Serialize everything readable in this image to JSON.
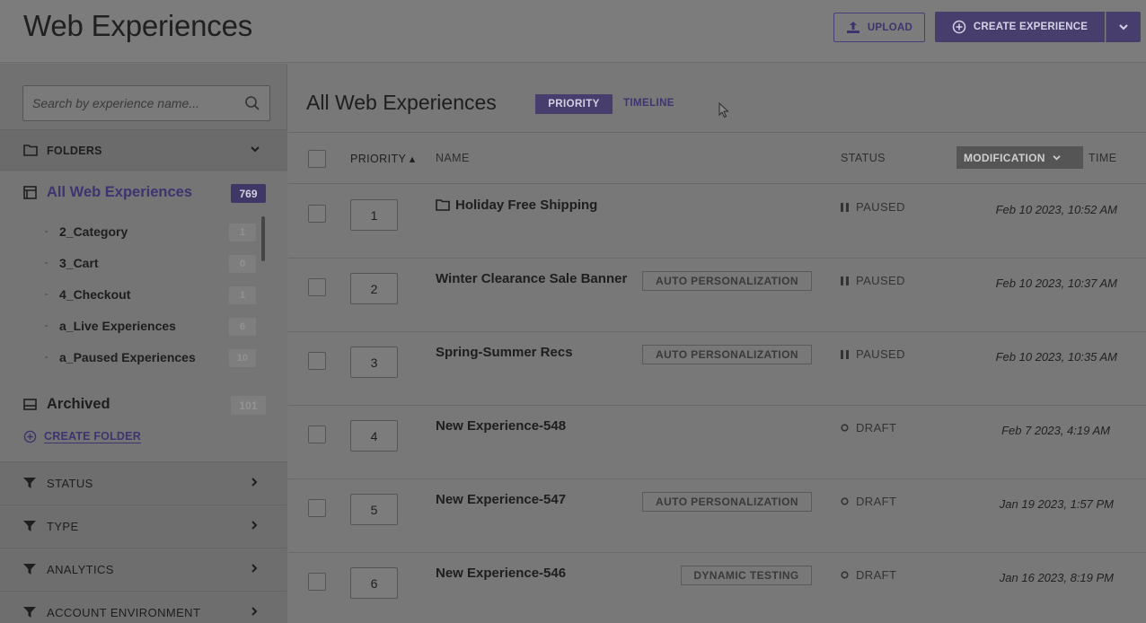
{
  "header": {
    "title": "Web Experiences",
    "upload_label": "UPLOAD",
    "create_label": "CREATE EXPERIENCE"
  },
  "sidebar": {
    "search_placeholder": "Search by experience name...",
    "folders_label": "FOLDERS",
    "all_label": "All Web Experiences",
    "all_count": "769",
    "subfolders": [
      {
        "label": "2_Category",
        "count": "1"
      },
      {
        "label": "3_Cart",
        "count": "0"
      },
      {
        "label": "4_Checkout",
        "count": "1"
      },
      {
        "label": "a_Live Experiences",
        "count": "6"
      },
      {
        "label": "a_Paused Experiences",
        "count": "10"
      }
    ],
    "archived_label": "Archived",
    "archived_count": "101",
    "create_folder_label": "CREATE FOLDER",
    "filters": [
      {
        "label": "STATUS"
      },
      {
        "label": "TYPE"
      },
      {
        "label": "ANALYTICS"
      },
      {
        "label": "ACCOUNT ENVIRONMENT"
      }
    ]
  },
  "main": {
    "title": "All Web Experiences",
    "tab_priority": "PRIORITY",
    "tab_timeline": "TIMELINE",
    "columns": {
      "priority": "PRIORITY ▴",
      "name": "NAME",
      "status": "STATUS",
      "modification": "MODIFICATION",
      "time": "TIME"
    },
    "rows": [
      {
        "priority": "1",
        "name": "Holiday Free Shipping",
        "tag": "",
        "status": "PAUSED",
        "time": "Feb 10 2023, 10:52 AM"
      },
      {
        "priority": "2",
        "name": "Winter Clearance Sale Banner",
        "tag": "AUTO PERSONALIZATION",
        "status": "PAUSED",
        "time": "Feb 10 2023, 10:37 AM"
      },
      {
        "priority": "3",
        "name": "Spring-Summer Recs",
        "tag": "AUTO PERSONALIZATION",
        "status": "PAUSED",
        "time": "Feb 10 2023, 10:35 AM"
      },
      {
        "priority": "4",
        "name": "New Experience-548",
        "tag": "",
        "status": "DRAFT",
        "time": "Feb 7 2023, 4:19 AM"
      },
      {
        "priority": "5",
        "name": "New Experience-547",
        "tag": "AUTO PERSONALIZATION",
        "status": "DRAFT",
        "time": "Jan 19 2023, 1:57 PM"
      },
      {
        "priority": "6",
        "name": "New Experience-546",
        "tag": "DYNAMIC TESTING",
        "status": "DRAFT",
        "time": "Jan 16 2023, 8:19 PM"
      }
    ]
  },
  "colors": {
    "accent": "#473e6e",
    "overlay_bg": "#787878"
  }
}
